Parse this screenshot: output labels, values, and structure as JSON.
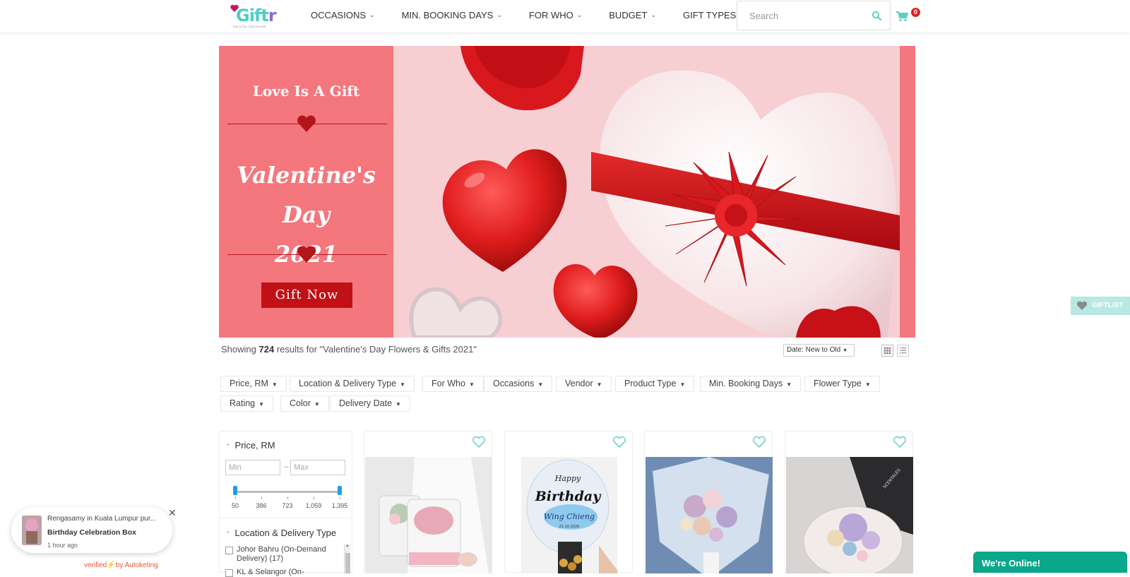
{
  "header": {
    "logo_text": "Giftr",
    "logo_sub": "MALAYSIA | SINGAPORE",
    "nav": [
      {
        "label": "OCCASIONS"
      },
      {
        "label": "MIN. BOOKING DAYS"
      },
      {
        "label": "FOR WHO"
      },
      {
        "label": "BUDGET"
      },
      {
        "label": "GIFT TYPES"
      }
    ],
    "search_placeholder": "Search",
    "cart_count": "0"
  },
  "banner": {
    "tagline": "Love Is A Gift",
    "title_line1": "Valentine's Day",
    "title_line2": "2021",
    "cta": "Gift Now"
  },
  "results": {
    "prefix": "Showing",
    "count": "724",
    "suffix": "results for \"Valentine's Day Flowers & Gifts 2021\"",
    "sort_label": "Date: New to Old"
  },
  "filters": [
    {
      "label": "Price, RM"
    },
    {
      "label": "Location & Delivery Type"
    },
    {
      "label": "For Who"
    },
    {
      "label": "Occasions"
    },
    {
      "label": "Vendor"
    },
    {
      "label": "Product Type"
    },
    {
      "label": "Min. Booking Days"
    },
    {
      "label": "Flower Type"
    },
    {
      "label": "Rating"
    },
    {
      "label": "Color"
    },
    {
      "label": "Delivery Date"
    }
  ],
  "sidebar": {
    "price_heading": "Price, RM",
    "min_placeholder": "Min",
    "max_placeholder": "Max",
    "dash": "–",
    "slider_ticks": [
      "50",
      "386",
      "723",
      "1,059",
      "1,395"
    ],
    "slider_range": [
      50,
      1395
    ],
    "slider_value": [
      50,
      1395
    ],
    "location_heading": "Location & Delivery Type",
    "location_options": [
      {
        "label": "Johor Bahru (On-Demand Delivery) (17)"
      },
      {
        "label": "KL & Selangor (On-"
      }
    ]
  },
  "products": [
    {
      "name": "product-1"
    },
    {
      "name": "product-2",
      "balloon_text_1": "Happy",
      "balloon_text_2": "Birthday",
      "balloon_text_3": "Wing Chieng",
      "balloon_date": "21.10.2020"
    },
    {
      "name": "product-3"
    },
    {
      "name": "product-4",
      "box_text": "SCENTALES"
    }
  ],
  "giftlist_label": "GIFTLIST",
  "notification": {
    "line1": "Rengasamy in Kuala Lumpur pur...",
    "product": "Birthday Celebration Box",
    "time": "1 hour ago",
    "close": "✕",
    "verified_prefix": "verified",
    "verified_by": "by Autoketing"
  },
  "chat_label": "We're Online!",
  "colors": {
    "brand_teal": "#4ecdc4",
    "banner_coral": "#f4777d",
    "cta_red": "#c11016",
    "chat_green": "#0ba78b",
    "badge_red": "#e02020"
  }
}
